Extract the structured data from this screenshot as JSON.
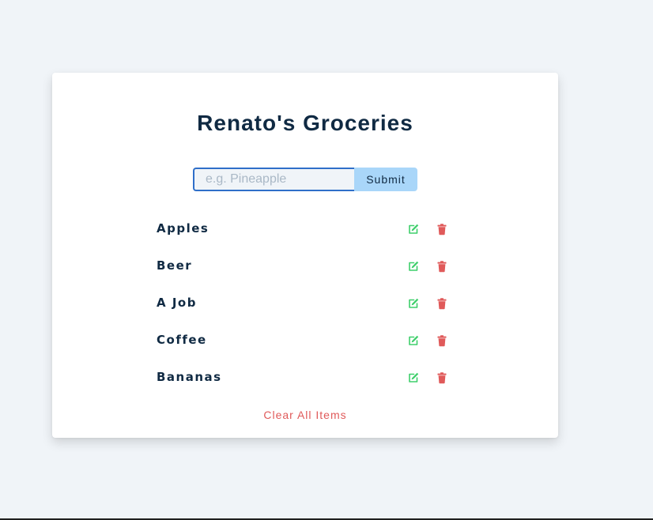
{
  "app": {
    "title": "Renato's Groceries"
  },
  "form": {
    "input_value": "",
    "input_placeholder": "e.g. Pineapple",
    "submit_label": "Submit"
  },
  "items": [
    {
      "label": "Apples"
    },
    {
      "label": "Beer"
    },
    {
      "label": "A Job"
    },
    {
      "label": "Coffee"
    },
    {
      "label": "Bananas"
    }
  ],
  "item_actions": {
    "edit_icon": "edit-icon",
    "delete_icon": "trash-icon"
  },
  "clear_label": "Clear All Items",
  "colors": {
    "background": "#f0f4f8",
    "title": "#102a43",
    "submit_bg": "#a9d6f9",
    "input_border": "#2f6fc9",
    "edit": "#3ecf6b",
    "delete": "#e05a5a",
    "clear": "#e05a5a"
  }
}
